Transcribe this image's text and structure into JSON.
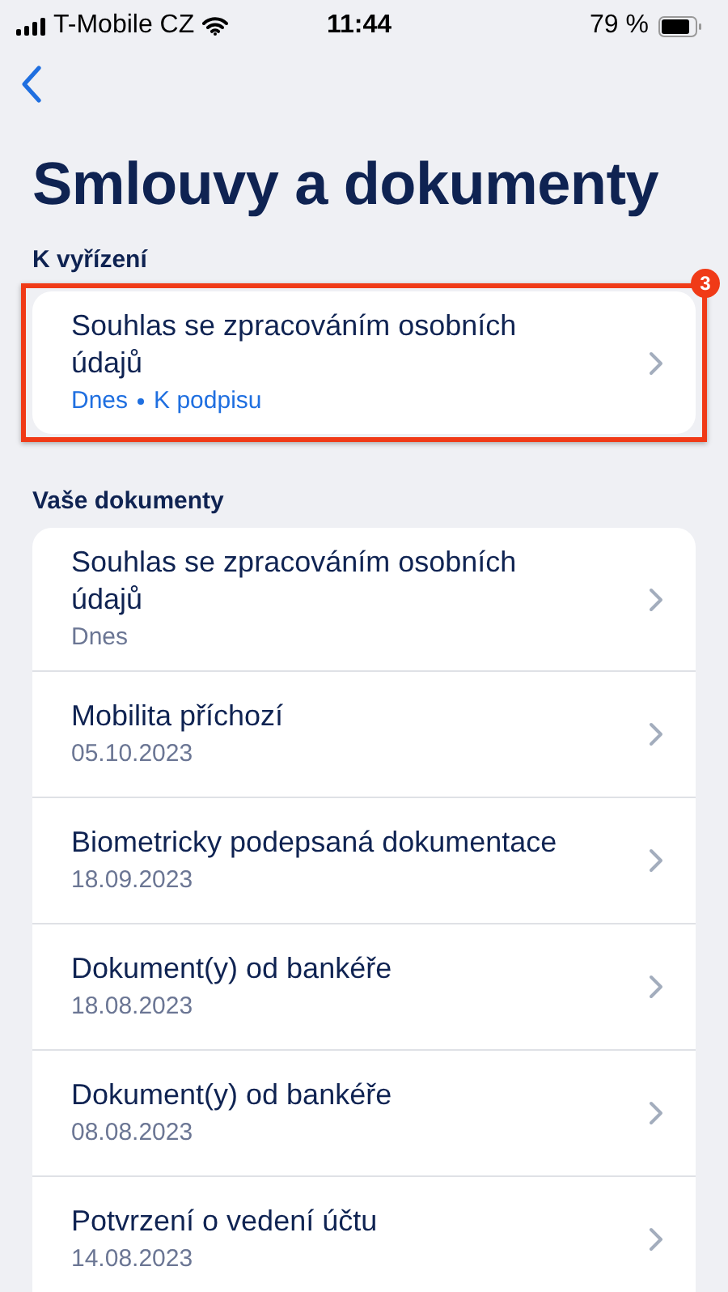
{
  "status_bar": {
    "carrier": "T-Mobile CZ",
    "time": "11:44",
    "battery": "79 %"
  },
  "title": "Smlouvy a dokumenty",
  "pending": {
    "label": "K vyřízení",
    "highlighted": true,
    "badge": "3",
    "items": [
      {
        "title": "Souhlas se zpracováním osobních údajů",
        "date": "Dnes",
        "status": "K podpisu"
      }
    ]
  },
  "documents": {
    "label": "Vaše dokumenty",
    "items": [
      {
        "title": "Souhlas se zpracováním osobních údajů",
        "date": "Dnes"
      },
      {
        "title": "Mobilita příchozí",
        "date": "05.10.2023"
      },
      {
        "title": "Biometricky podepsaná dokumentace",
        "date": "18.09.2023"
      },
      {
        "title": "Dokument(y) od bankéře",
        "date": "18.08.2023"
      },
      {
        "title": "Dokument(y) od bankéře",
        "date": "08.08.2023"
      },
      {
        "title": "Potvrzení o vedení účtu",
        "date": "14.08.2023"
      }
    ]
  }
}
